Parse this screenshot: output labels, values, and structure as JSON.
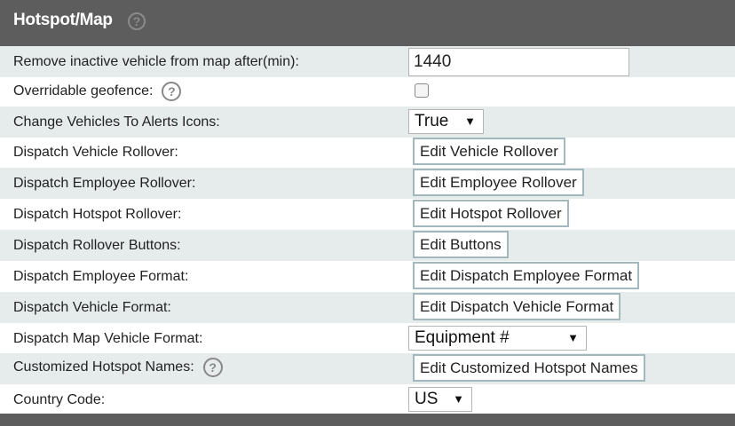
{
  "header": {
    "title": "Hotspot/Map",
    "help_icon": "?"
  },
  "rows": {
    "remove_inactive": {
      "label": "Remove inactive vehicle from map after(min):",
      "value": "1440"
    },
    "overridable_geofence": {
      "label": "Overridable geofence:",
      "help_icon": "?",
      "checked": false
    },
    "alerts_icons": {
      "label": "Change Vehicles To Alerts Icons:",
      "selected": "True",
      "arrow": "▼"
    },
    "vehicle_rollover": {
      "label": "Dispatch Vehicle Rollover:",
      "button": "Edit Vehicle Rollover"
    },
    "employee_rollover": {
      "label": "Dispatch Employee Rollover:",
      "button": "Edit Employee Rollover"
    },
    "hotspot_rollover": {
      "label": "Dispatch Hotspot Rollover:",
      "button": "Edit Hotspot Rollover"
    },
    "rollover_buttons": {
      "label": "Dispatch Rollover Buttons:",
      "button": "Edit Buttons"
    },
    "employee_format": {
      "label": "Dispatch Employee Format:",
      "button": "Edit Dispatch Employee Format"
    },
    "vehicle_format": {
      "label": "Dispatch Vehicle Format:",
      "button": "Edit Dispatch Vehicle Format"
    },
    "map_vehicle_format": {
      "label": "Dispatch Map Vehicle Format:",
      "selected": "Equipment #",
      "arrow": "▼"
    },
    "hotspot_names": {
      "label": "Customized Hotspot Names:",
      "help_icon": "?",
      "button": "Edit Customized Hotspot Names"
    },
    "country_code": {
      "label": "Country Code:",
      "selected": "US",
      "arrow": "▼"
    }
  },
  "colors": {
    "header_bg": "#5d5d5d",
    "row_shade": "#e6ecec",
    "button_border": "#a3b8bc"
  }
}
